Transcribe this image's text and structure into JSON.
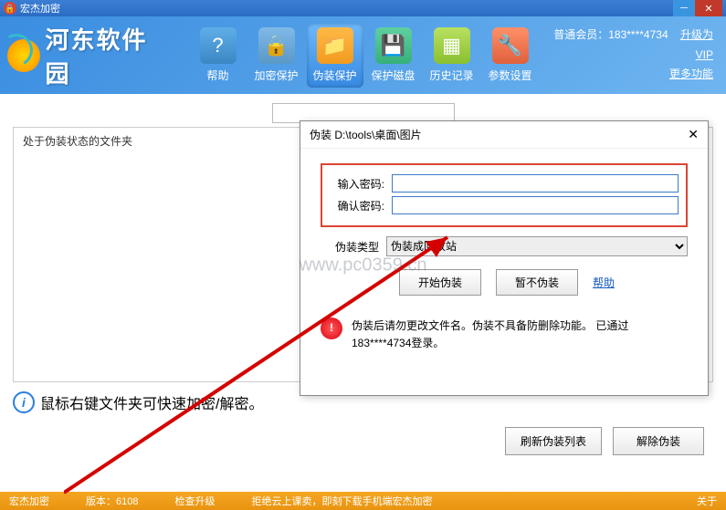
{
  "titlebar": {
    "app_name": "宏杰加密"
  },
  "logo": {
    "text": "河东软件园"
  },
  "toolbar": {
    "items": [
      {
        "label": "帮助"
      },
      {
        "label": "加密保护"
      },
      {
        "label": "伪装保护"
      },
      {
        "label": "保护磁盘"
      },
      {
        "label": "历史记录"
      },
      {
        "label": "参数设置"
      }
    ]
  },
  "header_right": {
    "member": "普通会员：183****4734",
    "upgrade": "升级为VIP",
    "more": "更多功能"
  },
  "panel": {
    "title": "处于伪装状态的文件夹"
  },
  "info_tip": "鼠标右键文件夹可快速加密/解密。",
  "main_buttons": {
    "refresh": "刷新伪装列表",
    "undo": "解除伪装"
  },
  "dialog": {
    "title": "伪装 D:\\tools\\桌面\\图片",
    "pw_label": "输入密码:",
    "pw_value": "",
    "confirm_label": "确认密码:",
    "confirm_value": "",
    "type_label": "伪装类型",
    "type_selected": "伪装成回收站",
    "start": "开始伪装",
    "cancel": "暂不伪装",
    "help": "帮助",
    "warn": "伪装后请勿更改文件名。伪装不具备防删除功能。   已通过183****4734登录。"
  },
  "status": {
    "app": "宏杰加密",
    "version_label": "版本：6108",
    "upgrade": "检查升级",
    "promo": "拒绝云上课卖，即刻下载手机端宏杰加密",
    "about": "关于"
  },
  "watermark": "www.pc0359.cn"
}
